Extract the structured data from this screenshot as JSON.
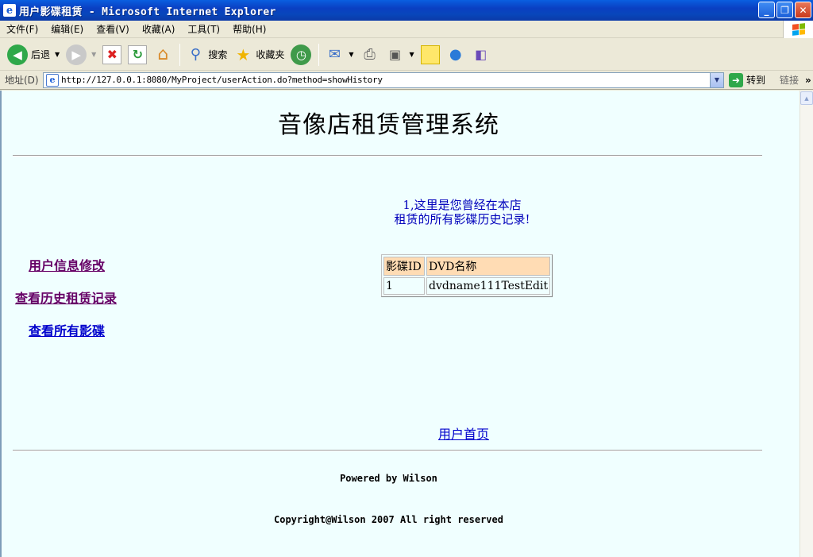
{
  "window": {
    "title": "用户影碟租赁 - Microsoft Internet Explorer",
    "minimize": "_",
    "restore": "❐",
    "close": "✕"
  },
  "menubar": {
    "items": [
      "文件(F)",
      "编辑(E)",
      "查看(V)",
      "收藏(A)",
      "工具(T)",
      "帮助(H)"
    ]
  },
  "toolbar": {
    "back_label": "后退",
    "search_label": "搜索",
    "favorites_label": "收藏夹"
  },
  "addressbar": {
    "label": "地址(D)",
    "url": "http://127.0.0.1:8080/MyProject/userAction.do?method=showHistory",
    "go_label": "转到",
    "links_label": "链接"
  },
  "page": {
    "heading": "音像店租赁管理系统",
    "sidebar": {
      "edit_user_info": "用户信息修改",
      "view_history": "查看历史租赁记录",
      "view_all_discs": "查看所有影碟"
    },
    "notice_line1": "1,这里是您曾经在本店",
    "notice_line2": "租赁的所有影碟历史记录!",
    "table": {
      "headers": [
        "影碟ID",
        "DVD名称"
      ],
      "rows": [
        [
          "1",
          "dvdname111TestEdit"
        ]
      ]
    },
    "home_link": "用户首页",
    "powered_by": "Powered by Wilson",
    "copyright": "Copyright@Wilson 2007 All right reserved"
  },
  "colors": {
    "page_background": "#f0ffff",
    "table_header_bg": "#ffdcb4",
    "link_unvisited": "#0000cc",
    "link_visited": "#660066"
  }
}
